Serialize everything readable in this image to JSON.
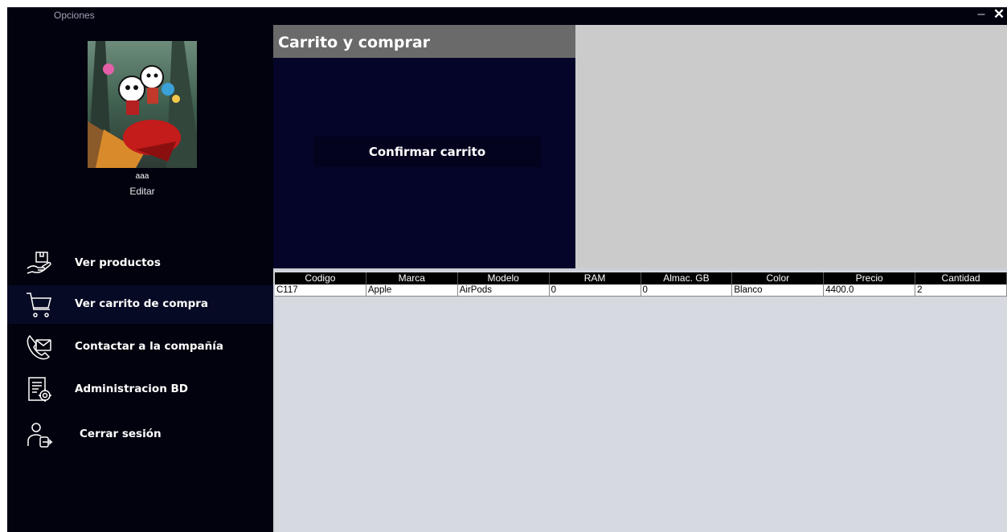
{
  "window": {
    "title": "Opciones",
    "minimize_glyph": "–",
    "close_glyph": "✕"
  },
  "user": {
    "name": "aaa",
    "edit_label": "Editar",
    "avatar_image": "cartoon characters on red rocket"
  },
  "sidebar": {
    "items": [
      {
        "label": "Ver productos",
        "icon": "hand-box-icon"
      },
      {
        "label": "Ver carrito de compra",
        "icon": "cart-icon"
      },
      {
        "label": "Contactar a la compañía",
        "icon": "phone-mail-icon"
      },
      {
        "label": "Administracion BD",
        "icon": "document-gear-icon"
      },
      {
        "label": "Cerrar sesión",
        "icon": "user-logout-icon"
      }
    ]
  },
  "cart": {
    "title": "Carrito y comprar",
    "confirm_label": "Confirmar carrito"
  },
  "table": {
    "columns": [
      "Codigo",
      "Marca",
      "Modelo",
      "RAM",
      "Almac. GB",
      "Color",
      "Precio",
      "Cantidad"
    ],
    "rows": [
      [
        "C117",
        "Apple",
        "AirPods",
        "0",
        "0",
        "Blanco",
        "4400.0",
        "2"
      ]
    ]
  },
  "colors": {
    "app_bg": "#02020e",
    "panel_bg": "#05052a",
    "header_gray": "#6a6a6a",
    "right_panel": "#cbcbcb",
    "table_bg": "#d6d9e0"
  }
}
